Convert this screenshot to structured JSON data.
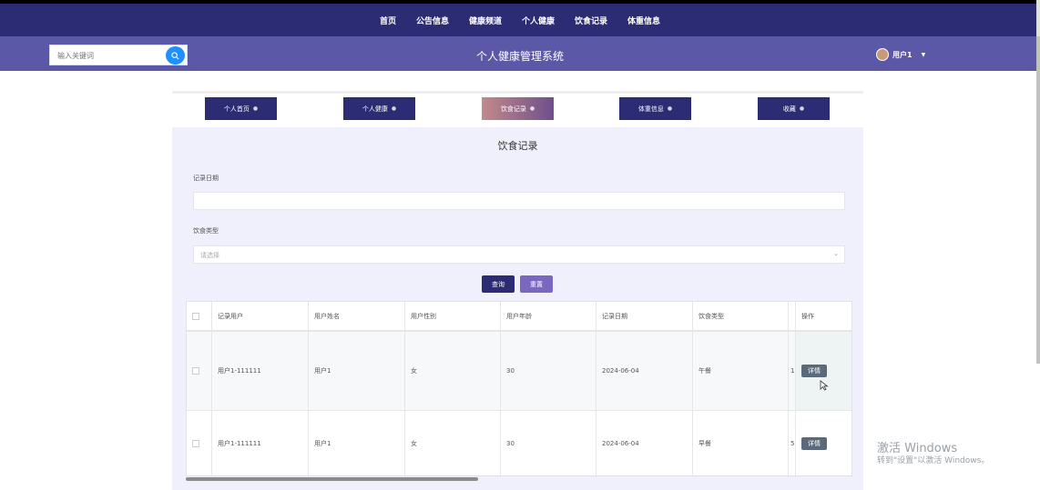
{
  "nav": [
    "首页",
    "公告信息",
    "健康频道",
    "个人健康",
    "饮食记录",
    "体重信息"
  ],
  "header": {
    "search_placeholder": "输入关键词",
    "title": "个人健康管理系统",
    "user": "用户1"
  },
  "tabs": [
    {
      "label": "个人首页",
      "active": false
    },
    {
      "label": "个人健康",
      "active": false
    },
    {
      "label": "饮食记录",
      "active": true
    },
    {
      "label": "体重信息",
      "active": false
    },
    {
      "label": "收藏",
      "active": false
    }
  ],
  "form": {
    "page_title": "饮食记录",
    "date_label": "记录日期",
    "type_label": "饮食类型",
    "type_placeholder": "请选择",
    "query_button": "查询",
    "reset_button": "重置"
  },
  "table": {
    "headers": [
      "记录用户",
      "用户姓名",
      "用户性别",
      "用户年龄",
      "记录日期",
      "饮食类型",
      "",
      "操作"
    ],
    "rows": [
      {
        "cells": [
          "用户1-111111",
          "用户1",
          "女",
          "30",
          "2024-06-04",
          "午餐",
          "1"
        ],
        "action": "详情"
      },
      {
        "cells": [
          "用户1-111111",
          "用户1",
          "女",
          "30",
          "2024-06-04",
          "早餐",
          "5"
        ],
        "action": "详情"
      }
    ]
  },
  "watermark": {
    "line1": "激活 Windows",
    "line2": "转到\"设置\"以激活 Windows。"
  },
  "colors": {
    "nav_bg": "#2b2c73",
    "header_bg": "#5b58a8",
    "content_bg": "#f0effc",
    "search_button": "#1e90ff",
    "reset_button": "#7a68c0"
  }
}
